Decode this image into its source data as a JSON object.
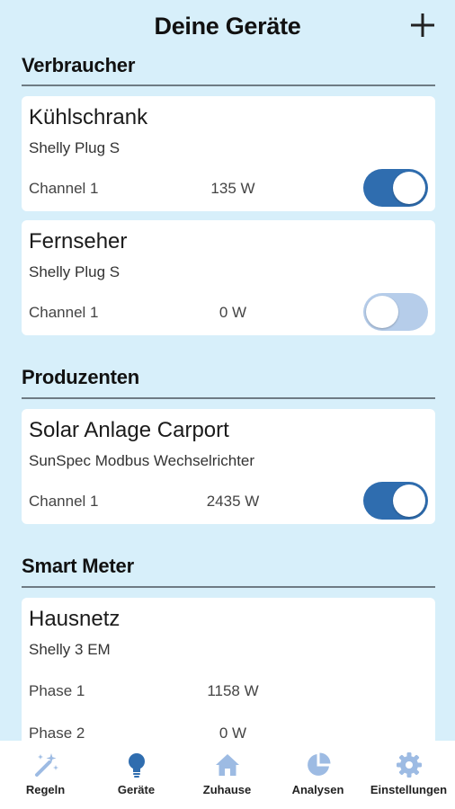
{
  "header": {
    "title": "Deine Geräte",
    "add_icon": "plus-icon"
  },
  "sections": [
    {
      "title": "Verbraucher",
      "devices": [
        {
          "name": "Kühlschrank",
          "type": "Shelly Plug S",
          "channels": [
            {
              "label": "Channel 1",
              "value": "135 W",
              "on": true
            }
          ]
        },
        {
          "name": "Fernseher",
          "type": "Shelly Plug S",
          "channels": [
            {
              "label": "Channel 1",
              "value": "0 W",
              "on": false
            }
          ]
        }
      ]
    },
    {
      "title": "Produzenten",
      "devices": [
        {
          "name": "Solar Anlage Carport",
          "type": "SunSpec Modbus Wechselrichter",
          "channels": [
            {
              "label": "Channel 1",
              "value": "2435 W",
              "on": true
            }
          ]
        }
      ]
    },
    {
      "title": "Smart Meter",
      "devices": [
        {
          "name": "Hausnetz",
          "type": "Shelly 3 EM",
          "phases": [
            {
              "label": "Phase 1",
              "value": "1158 W"
            },
            {
              "label": "Phase 2",
              "value": "0 W"
            }
          ]
        }
      ]
    }
  ],
  "nav": {
    "items": [
      {
        "label": "Regeln",
        "icon": "magic-wand-icon"
      },
      {
        "label": "Geräte",
        "icon": "lightbulb-icon",
        "active": true
      },
      {
        "label": "Zuhause",
        "icon": "home-icon"
      },
      {
        "label": "Analysen",
        "icon": "pie-chart-icon"
      },
      {
        "label": "Einstellungen",
        "icon": "gear-icon"
      }
    ]
  },
  "colors": {
    "background": "#d7effa",
    "toggle_on": "#2f6daf",
    "toggle_off": "#b6cdea",
    "nav_icon_active": "#2f6daf",
    "nav_icon_inactive": "#9dbbe3"
  }
}
